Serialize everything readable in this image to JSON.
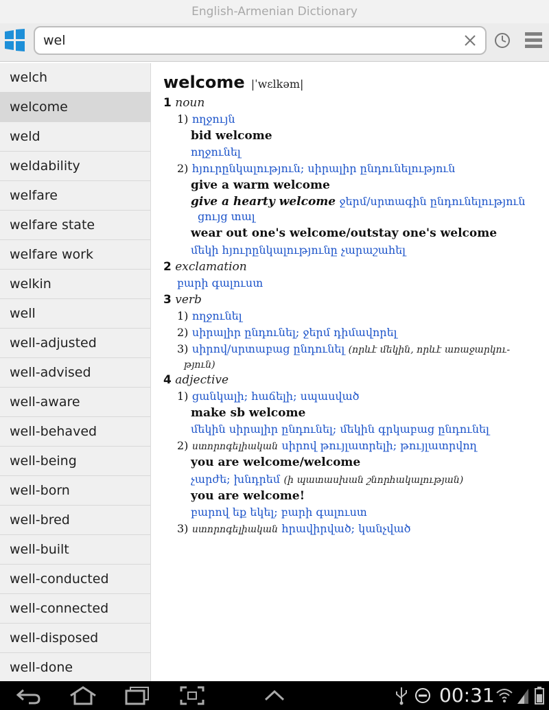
{
  "app": {
    "title": "English-Armenian Dictionary"
  },
  "search": {
    "value": "wel"
  },
  "word_list": [
    "welch",
    "welcome",
    "weld",
    "weldability",
    "welfare",
    "welfare state",
    "welfare work",
    "welkin",
    "well",
    "well-adjusted",
    "well-advised",
    "well-aware",
    "well-behaved",
    "well-being",
    "well-born",
    "well-bred",
    "well-built",
    "well-conducted",
    "well-connected",
    "well-disposed",
    "well-done"
  ],
  "selected_word": "welcome",
  "entry": {
    "headword": "welcome",
    "pronunciation": "|ˈwɛlkəm|",
    "pos1": {
      "num": "1",
      "label": "noun"
    },
    "n1": {
      "num": "1)",
      "arm": "ողջույն"
    },
    "bid_welcome": "bid welcome",
    "bid_welcome_arm": "ողջունել",
    "n2": {
      "num": "2)",
      "arm": "հյուրընկալություն; սիրալիր ընդունելություն"
    },
    "give_warm": "give a warm welcome",
    "give_hearty": "give a hearty welcome",
    "give_hearty_arm": "ջերմ/սրտագին ընդունելություն",
    "give_hearty_arm2": "ցույց տալ",
    "wear_out": "wear out one's welcome/outstay one's welcome",
    "wear_out_arm": "մեկի հյուրընկալությունը չարաշահել",
    "pos2": {
      "num": "2",
      "label": "exclamation"
    },
    "excl_arm": "բարի գալուստ",
    "pos3": {
      "num": "3",
      "label": "verb"
    },
    "v1": {
      "num": "1)",
      "arm": "ողջունել"
    },
    "v2": {
      "num": "2)",
      "arm": "սիրալիր ընդունել; ջերմ դիմավորել"
    },
    "v3": {
      "num": "3)",
      "arm": "սիրով/սրտաբաց ընդունել",
      "note": "(որևէ մեկին, որևէ առաջարկու-",
      "note2": "թյուն)"
    },
    "pos4": {
      "num": "4",
      "label": "adjective"
    },
    "a1": {
      "num": "1)",
      "arm": "ցանկալի; հաճելի; սպասված"
    },
    "make_sb": "make sb welcome",
    "make_sb_arm": "մեկին սիրալիր ընդունել; մեկին գրկաբաց ընդունել",
    "a2": {
      "num": "2)",
      "note": "ստորոգելիական",
      "arm": "սիրով թույլատրելի; թույլատրվող"
    },
    "you_welcome": "you are welcome/welcome",
    "you_welcome_arm": "չարժե; խնդրեմ",
    "you_welcome_note": "(ի պատասխան շնորհակալության)",
    "you_welcome_excl": "you are welcome!",
    "you_welcome_excl_arm": "բարով եք եկել; բարի գալուստ",
    "a3": {
      "num": "3)",
      "note": "ստորոգելիական",
      "arm": "հրավիրված; կանչված"
    }
  },
  "statusbar": {
    "time": "00:31"
  },
  "colors": {
    "link_blue": "#1a52c9",
    "list_bg": "#f0f0f0",
    "selected_bg": "#d8d8d8"
  }
}
